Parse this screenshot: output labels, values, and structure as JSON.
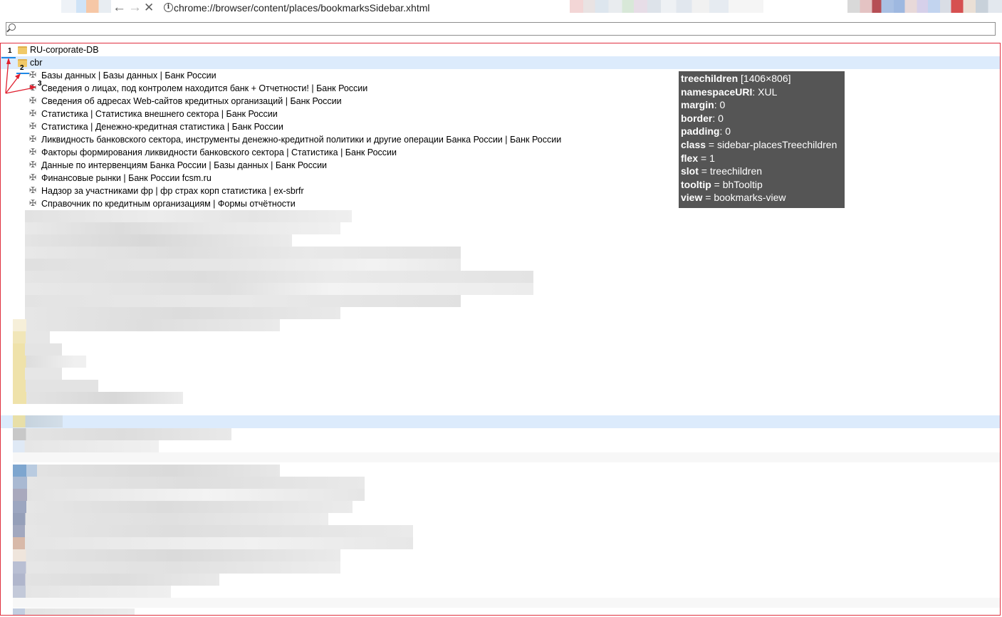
{
  "toolbar": {
    "back_glyph": "←",
    "forward_glyph": "→",
    "close_glyph": "✕",
    "info_glyph": "i",
    "url": "chrome://browser/content/places/bookmarksSidebar.xhtml"
  },
  "search": {
    "placeholder": ""
  },
  "tree": {
    "folders": [
      {
        "label": "RU-corporate-DB"
      },
      {
        "label": "cbr"
      }
    ],
    "bookmarks": [
      {
        "label": "Базы данных | Базы данных | Банк России"
      },
      {
        "label": "Сведения о лицах, под контролем находится банк + Отчетности! | Банк России"
      },
      {
        "label": "Сведения об адресах Web-сайтов кредитных организаций | Банк России"
      },
      {
        "label": "Статистика | Статистика внешнего сектора | Банк России"
      },
      {
        "label": "Статистика | Денежно-кредитная статистика | Банк России"
      },
      {
        "label": "Ликвидность банковского сектора, инструменты денежно-кредитной политики и другие операции Банка России | Банк России"
      },
      {
        "label": "Факторы формирования ликвидности банковского сектора | Статистика | Банк России"
      },
      {
        "label": "Данные по интервенциям Банка России  | Базы данных | Банк России"
      },
      {
        "label": "Финансовые рынки | Банк России fcsm.ru"
      },
      {
        "label": "Надзор за участниками фр | фр страх корп статистика | ex-sbrfr"
      },
      {
        "label": "Справочник по кредитным организациям | Формы отчётности"
      }
    ]
  },
  "markers": {
    "m1": "1",
    "m2": "2",
    "m3": "3"
  },
  "inspector": {
    "tag": "treechildren",
    "dims": " [1406×806]",
    "rows": [
      {
        "key": "namespaceURI",
        "sep": ": ",
        "value": "XUL"
      },
      {
        "key": "margin",
        "sep": ": ",
        "value": "0"
      },
      {
        "key": "border",
        "sep": ": ",
        "value": "0"
      },
      {
        "key": "padding",
        "sep": ": ",
        "value": "0"
      },
      {
        "key": "class",
        "sep": " = ",
        "value": "sidebar-placesTreechildren"
      },
      {
        "key": "flex",
        "sep": " = ",
        "value": "1"
      },
      {
        "key": "slot",
        "sep": " = ",
        "value": "treechildren"
      },
      {
        "key": "tooltip",
        "sep": " = ",
        "value": "bhTooltip"
      },
      {
        "key": "view",
        "sep": " = ",
        "value": "bookmarks-view"
      }
    ]
  },
  "colors": {
    "selection": "#dcebfc",
    "frame": "#e0303f",
    "inspector_bg": "#555555",
    "marker_line": "#1e88e5",
    "arrow": "#e0202f"
  }
}
